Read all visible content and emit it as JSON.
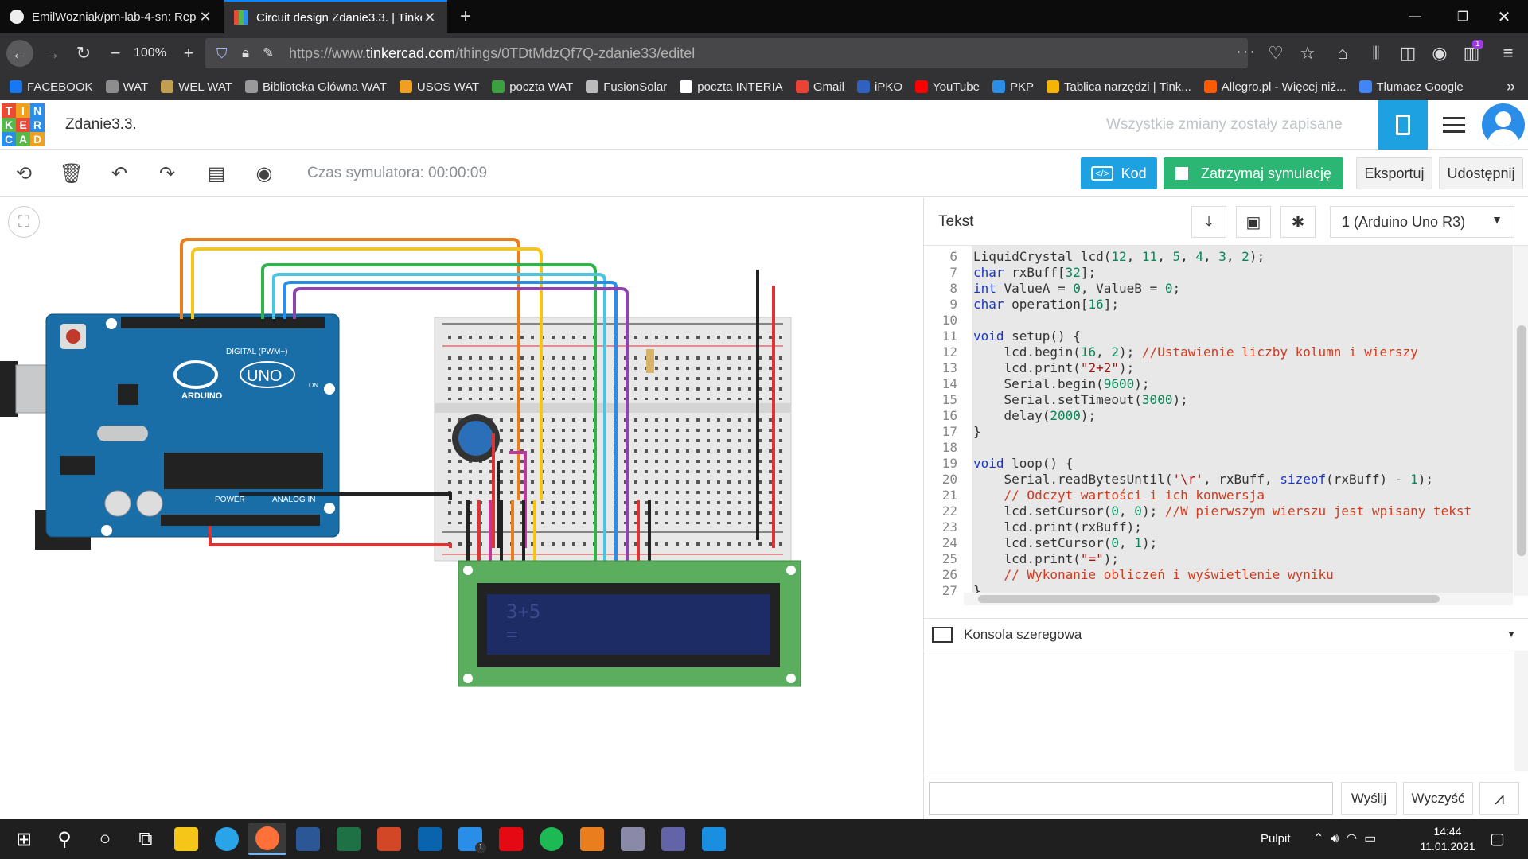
{
  "browser": {
    "tabs": [
      {
        "title": "EmilWozniak/pm-lab-4-sn: Rep",
        "active": false
      },
      {
        "title": "Circuit design Zdanie3.3. | Tinke",
        "active": true
      }
    ],
    "new_tab_icon": "plus-icon",
    "zoom": "100%",
    "url_prefix": "https://www.",
    "url_domain": "tinkercad.com",
    "url_path": "/things/0TDtMdzQf7Q-zdanie33/editel",
    "badge_count": "1"
  },
  "bookmarks": [
    {
      "label": "FACEBOOK",
      "color": "#1877f2"
    },
    {
      "label": "WAT",
      "color": "#8d8d8d"
    },
    {
      "label": "WEL WAT",
      "color": "#c0a050"
    },
    {
      "label": "Biblioteka Główna WAT",
      "color": "#9a9a9a"
    },
    {
      "label": "USOS WAT",
      "color": "#f0a020"
    },
    {
      "label": "poczta WAT",
      "color": "#3aa040"
    },
    {
      "label": "FusionSolar",
      "color": "#bbbbbb"
    },
    {
      "label": "poczta INTERIA",
      "color": "#ffffff"
    },
    {
      "label": "Gmail",
      "color": "#ea4335"
    },
    {
      "label": "iPKO",
      "color": "#3060c0"
    },
    {
      "label": "YouTube",
      "color": "#ff0000"
    },
    {
      "label": "PKP",
      "color": "#2a8ee8"
    },
    {
      "label": "Tablica narzędzi | Tink...",
      "color": "#f4b400"
    },
    {
      "label": "Allegro.pl - Więcej niż...",
      "color": "#ff5a00"
    },
    {
      "label": "Tłumacz Google",
      "color": "#4285f4"
    }
  ],
  "tinkercad": {
    "logo_letters": [
      "T",
      "I",
      "N",
      "K",
      "E",
      "R",
      "C",
      "A",
      "D"
    ],
    "design_title": "Zdanie3.3.",
    "saved_status": "Wszystkie zmiany zostały zapisane",
    "sim_time_label": "Czas symulatora: 00:00:09",
    "buttons": {
      "code": "Kod",
      "stop_sim": "Zatrzymaj symulację",
      "export": "Eksportuj",
      "share": "Udostępnij"
    }
  },
  "circuit": {
    "board_label": "UNO",
    "board_brand": "ARDUINO",
    "digital_label": "DIGITAL (PWM~)",
    "power_label": "POWER",
    "analog_label": "ANALOG IN",
    "on_label": "ON",
    "lcd_line1": "3+5",
    "lcd_line2": "="
  },
  "code_panel": {
    "mode_label": "Tekst",
    "device_select": "1 (Arduino Uno R3)",
    "lines": [
      {
        "n": "6",
        "html": "LiquidCrystal lcd(<span class=\"num\">12</span>, <span class=\"num\">11</span>, <span class=\"num\">5</span>, <span class=\"num\">4</span>, <span class=\"num\">3</span>, <span class=\"num\">2</span>);"
      },
      {
        "n": "7",
        "html": "<span class=\"kw\">char</span> rxBuff[<span class=\"num\">32</span>];"
      },
      {
        "n": "8",
        "html": "<span class=\"kw\">int</span> ValueA = <span class=\"num\">0</span>, ValueB = <span class=\"num\">0</span>;"
      },
      {
        "n": "9",
        "html": "<span class=\"kw\">char</span> operation[<span class=\"num\">16</span>];"
      },
      {
        "n": "10",
        "html": ""
      },
      {
        "n": "11",
        "html": "<span class=\"kw\">void</span> setup() {"
      },
      {
        "n": "12",
        "html": "    lcd.begin(<span class=\"num\">16</span>, <span class=\"num\">2</span>); <span class=\"cm\">//Ustawienie liczby kolumn i wierszy</span>"
      },
      {
        "n": "13",
        "html": "    lcd.print(<span class=\"str\">\"2+2\"</span>);"
      },
      {
        "n": "14",
        "html": "    Serial.begin(<span class=\"num\">9600</span>);"
      },
      {
        "n": "15",
        "html": "    Serial.setTimeout(<span class=\"num\">3000</span>);"
      },
      {
        "n": "16",
        "html": "    delay(<span class=\"num\">2000</span>);"
      },
      {
        "n": "17",
        "html": "}"
      },
      {
        "n": "18",
        "html": ""
      },
      {
        "n": "19",
        "html": "<span class=\"kw\">void</span> loop() {"
      },
      {
        "n": "20",
        "html": "    Serial.readBytesUntil(<span class=\"str\">'\\r'</span>, rxBuff, <span class=\"kw\">sizeof</span>(rxBuff) - <span class=\"num\">1</span>);"
      },
      {
        "n": "21",
        "html": "    <span class=\"cm\">// Odczyt wartości i ich konwersja</span>"
      },
      {
        "n": "22",
        "html": "    lcd.setCursor(<span class=\"num\">0</span>, <span class=\"num\">0</span>); <span class=\"cm\">//W pierwszym wierszu jest wpisany tekst</span>"
      },
      {
        "n": "23",
        "html": "    lcd.print(rxBuff);"
      },
      {
        "n": "24",
        "html": "    lcd.setCursor(<span class=\"num\">0</span>, <span class=\"num\">1</span>);"
      },
      {
        "n": "25",
        "html": "    lcd.print(<span class=\"str\">\"=\"</span>);"
      },
      {
        "n": "26",
        "html": "    <span class=\"cm\">// Wykonanie obliczeń i wyświetlenie wyniku</span>"
      },
      {
        "n": "27",
        "html": "}"
      }
    ],
    "serial_console_label": "Konsola szeregowa",
    "serial_input_value": "",
    "send_label": "Wyślij",
    "clear_label": "Wyczyść"
  },
  "taskbar": {
    "apps": [
      "start-icon",
      "search-icon",
      "cortana-icon",
      "task-view-icon",
      "file-explorer-icon",
      "edge-icon",
      "firefox-icon",
      "word-icon",
      "excel-icon",
      "powerpoint-icon",
      "outlook-icon",
      "mail-icon",
      "netflix-icon",
      "spotify-icon",
      "matlab-icon",
      "calculator-app-icon",
      "teams-icon",
      "vscode-icon"
    ],
    "tray_label": "Pulpit",
    "time": "14:44",
    "date": "11.01.2021",
    "mail_badge": "1"
  }
}
